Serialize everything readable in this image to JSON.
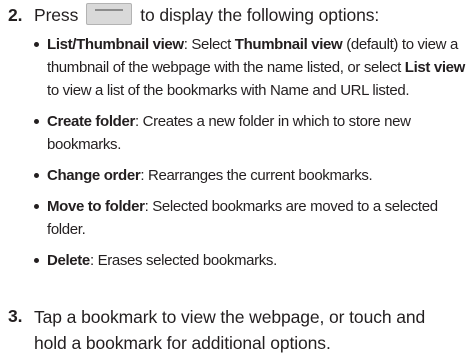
{
  "step2": {
    "number": "2.",
    "before": "Press",
    "after": "to display the following options:",
    "icon": "menu-key-icon"
  },
  "options": [
    {
      "parts": [
        {
          "t": "List/Thumbnail view",
          "b": true
        },
        {
          "t": ": Select ",
          "b": false
        },
        {
          "t": "Thumbnail view",
          "b": true
        },
        {
          "t": " (default) to view a thumbnail of the webpage with the name listed, or select ",
          "b": false
        },
        {
          "t": "List view",
          "b": true
        },
        {
          "t": " to view a list of the bookmarks with Name and URL listed.",
          "b": false
        }
      ]
    },
    {
      "parts": [
        {
          "t": "Create folder",
          "b": true
        },
        {
          "t": ": Creates a new folder in which to store new bookmarks.",
          "b": false
        }
      ]
    },
    {
      "parts": [
        {
          "t": "Change order",
          "b": true
        },
        {
          "t": ": Rearranges the current bookmarks.",
          "b": false
        }
      ]
    },
    {
      "parts": [
        {
          "t": "Move to folder",
          "b": true
        },
        {
          "t": ": Selected bookmarks are moved to a selected folder.",
          "b": false
        }
      ]
    },
    {
      "parts": [
        {
          "t": "Delete",
          "b": true
        },
        {
          "t": ": Erases selected bookmarks.",
          "b": false
        }
      ]
    }
  ],
  "step3": {
    "number": "3.",
    "text": "Tap a bookmark to view the webpage, or touch and hold a bookmark for additional options."
  }
}
